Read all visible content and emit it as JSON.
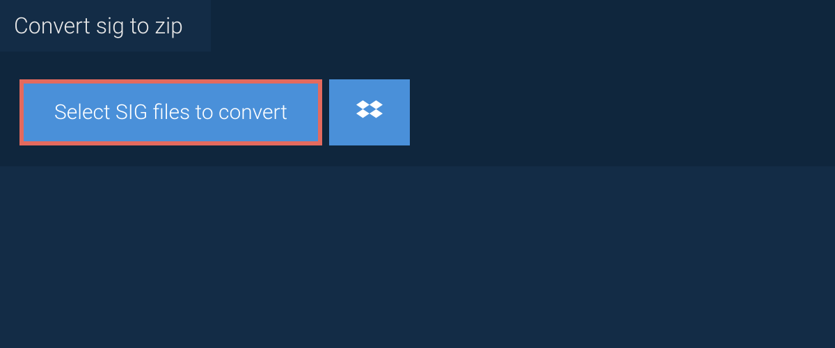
{
  "tab": {
    "title": "Convert sig to zip"
  },
  "actions": {
    "select_label": "Select SIG files to convert"
  },
  "colors": {
    "page_bg": "#132c46",
    "panel_bg": "#0f263d",
    "button_bg": "#4a90d9",
    "highlight_border": "#e46a5e"
  }
}
